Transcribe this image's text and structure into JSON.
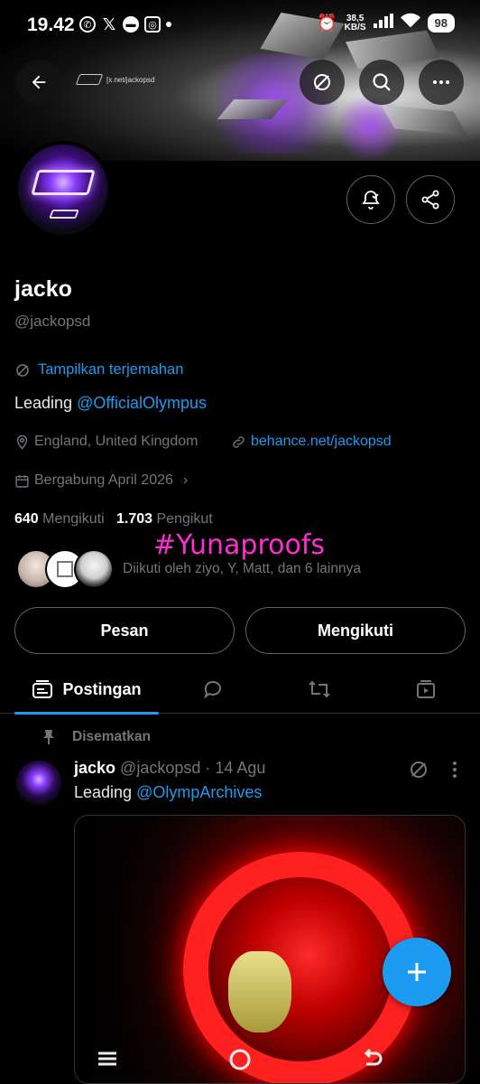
{
  "status_bar": {
    "time": "19.42",
    "network_speed_value": "38,5",
    "network_speed_unit": "KB/S",
    "battery": "98"
  },
  "header": {
    "banner_small_text": "[x.net/jackopsd"
  },
  "profile": {
    "name": "jacko",
    "handle": "@jackopsd",
    "translate_label": "Tampilkan terjemahan",
    "bio_prefix": "Leading ",
    "bio_mention": "@OfficialOlympus",
    "location": "England, United Kingdom",
    "website": "behance.net/jackopsd",
    "joined": "Bergabung April 2026",
    "following_count": "640",
    "following_label": "Mengikuti",
    "followers_count": "1.703",
    "followers_label": "Pengikut",
    "followed_by": "Diikuti oleh ziyo, Y, Matt, dan 6 lainnya",
    "overlay_tag": "#Yunaproofs"
  },
  "actions": {
    "message_label": "Pesan",
    "following_button_label": "Mengikuti"
  },
  "tabs": {
    "posts_label": "Postingan"
  },
  "post": {
    "pinned_label": "Disematkan",
    "name": "jacko",
    "handle": "@jackopsd",
    "date": "· 14 Agu",
    "text_prefix": "Leading ",
    "text_mention": "@OlympArchives"
  },
  "colors": {
    "accent": "#1d9bf0",
    "overlay_tag": "#ff2ed1",
    "background": "#000000"
  }
}
